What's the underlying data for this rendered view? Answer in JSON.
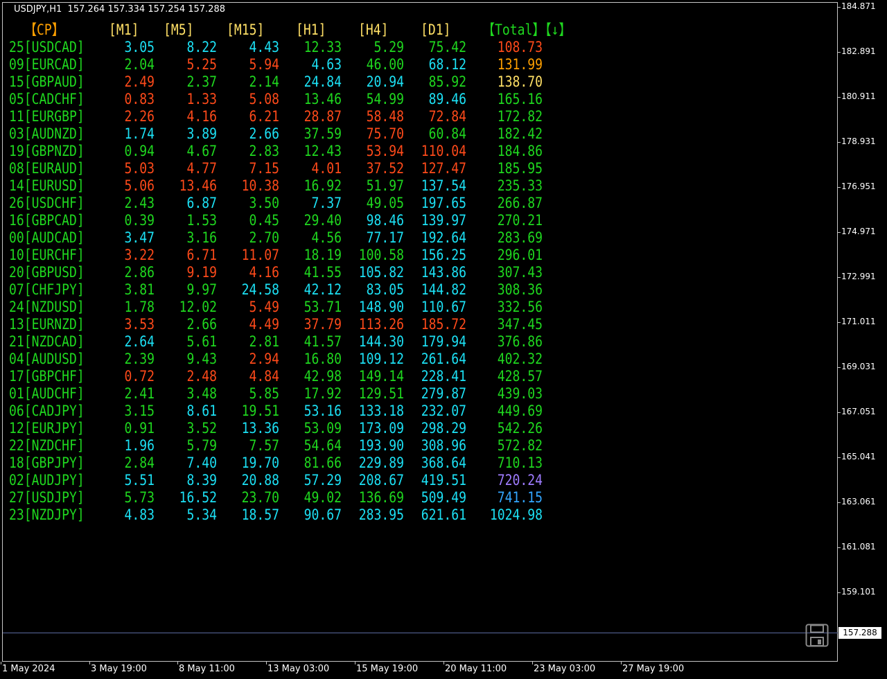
{
  "title": "USDJPY,H1  157.264 157.334 157.254 157.288",
  "colors": {
    "green": "#1fd81f",
    "cyan": "#1ce1f5",
    "red": "#ff4a1a",
    "orange": "#ffa000",
    "yellow": "#ffe066",
    "purple": "#9f7cff",
    "blue": "#33a6ff",
    "background": "#000000"
  },
  "headers": {
    "cp": "【CP】",
    "m1": "[M1]",
    "m5": "[M5]",
    "m15": "[M15]",
    "h1": "[H1]",
    "h4": "[H4]",
    "d1": "[D1]",
    "total": "【Total】【↓】"
  },
  "header_colors": {
    "cp": "#ffa000",
    "m1": "#ffe066",
    "m5": "#ffe066",
    "m15": "#ffe066",
    "h1": "#ffe066",
    "h4": "#ffe066",
    "d1": "#ffe066",
    "total": "#1fd81f"
  },
  "rows": [
    {
      "label": "25[USDCAD]",
      "m1": "3.05",
      "m5": "8.22",
      "m15": "4.43",
      "h1": "12.33",
      "h4": "5.29",
      "d1": "75.42",
      "total": "108.73",
      "c": [
        "cyan",
        "cyan",
        "cyan",
        "green",
        "green",
        "green",
        "red"
      ]
    },
    {
      "label": "09[EURCAD]",
      "m1": "2.04",
      "m5": "5.25",
      "m15": "5.94",
      "h1": "4.63",
      "h4": "46.00",
      "d1": "68.12",
      "total": "131.99",
      "c": [
        "green",
        "red",
        "red",
        "cyan",
        "green",
        "cyan",
        "orange"
      ]
    },
    {
      "label": "15[GBPAUD]",
      "m1": "2.49",
      "m5": "2.37",
      "m15": "2.14",
      "h1": "24.84",
      "h4": "20.94",
      "d1": "85.92",
      "total": "138.70",
      "c": [
        "red",
        "green",
        "green",
        "cyan",
        "cyan",
        "green",
        "yellow"
      ]
    },
    {
      "label": "05[CADCHF]",
      "m1": "0.83",
      "m5": "1.33",
      "m15": "5.08",
      "h1": "13.46",
      "h4": "54.99",
      "d1": "89.46",
      "total": "165.16",
      "c": [
        "red",
        "red",
        "red",
        "green",
        "green",
        "cyan",
        "green"
      ]
    },
    {
      "label": "11[EURGBP]",
      "m1": "2.26",
      "m5": "4.16",
      "m15": "6.21",
      "h1": "28.87",
      "h4": "58.48",
      "d1": "72.84",
      "total": "172.82",
      "c": [
        "red",
        "red",
        "red",
        "red",
        "red",
        "red",
        "green"
      ]
    },
    {
      "label": "03[AUDNZD]",
      "m1": "1.74",
      "m5": "3.89",
      "m15": "2.66",
      "h1": "37.59",
      "h4": "75.70",
      "d1": "60.84",
      "total": "182.42",
      "c": [
        "cyan",
        "cyan",
        "cyan",
        "green",
        "red",
        "green",
        "green"
      ]
    },
    {
      "label": "19[GBPNZD]",
      "m1": "0.94",
      "m5": "4.67",
      "m15": "2.83",
      "h1": "12.43",
      "h4": "53.94",
      "d1": "110.04",
      "total": "184.86",
      "c": [
        "green",
        "green",
        "green",
        "green",
        "red",
        "red",
        "green"
      ]
    },
    {
      "label": "08[EURAUD]",
      "m1": "5.03",
      "m5": "4.77",
      "m15": "7.15",
      "h1": "4.01",
      "h4": "37.52",
      "d1": "127.47",
      "total": "185.95",
      "c": [
        "red",
        "red",
        "red",
        "red",
        "red",
        "red",
        "green"
      ]
    },
    {
      "label": "14[EURUSD]",
      "m1": "5.06",
      "m5": "13.46",
      "m15": "10.38",
      "h1": "16.92",
      "h4": "51.97",
      "d1": "137.54",
      "total": "235.33",
      "c": [
        "red",
        "red",
        "red",
        "green",
        "green",
        "cyan",
        "green"
      ]
    },
    {
      "label": "26[USDCHF]",
      "m1": "2.43",
      "m5": "6.87",
      "m15": "3.50",
      "h1": "7.37",
      "h4": "49.05",
      "d1": "197.65",
      "total": "266.87",
      "c": [
        "green",
        "cyan",
        "green",
        "cyan",
        "green",
        "cyan",
        "green"
      ]
    },
    {
      "label": "16[GBPCAD]",
      "m1": "0.39",
      "m5": "1.53",
      "m15": "0.45",
      "h1": "29.40",
      "h4": "98.46",
      "d1": "139.97",
      "total": "270.21",
      "c": [
        "green",
        "green",
        "green",
        "green",
        "cyan",
        "cyan",
        "green"
      ]
    },
    {
      "label": "00[AUDCAD]",
      "m1": "3.47",
      "m5": "3.16",
      "m15": "2.70",
      "h1": "4.56",
      "h4": "77.17",
      "d1": "192.64",
      "total": "283.69",
      "c": [
        "cyan",
        "green",
        "green",
        "green",
        "cyan",
        "cyan",
        "green"
      ]
    },
    {
      "label": "10[EURCHF]",
      "m1": "3.22",
      "m5": "6.71",
      "m15": "11.07",
      "h1": "18.19",
      "h4": "100.58",
      "d1": "156.25",
      "total": "296.01",
      "c": [
        "red",
        "red",
        "red",
        "green",
        "green",
        "cyan",
        "green"
      ]
    },
    {
      "label": "20[GBPUSD]",
      "m1": "2.86",
      "m5": "9.19",
      "m15": "4.16",
      "h1": "41.55",
      "h4": "105.82",
      "d1": "143.86",
      "total": "307.43",
      "c": [
        "green",
        "red",
        "red",
        "green",
        "cyan",
        "cyan",
        "green"
      ]
    },
    {
      "label": "07[CHFJPY]",
      "m1": "3.81",
      "m5": "9.97",
      "m15": "24.58",
      "h1": "42.12",
      "h4": "83.05",
      "d1": "144.82",
      "total": "308.36",
      "c": [
        "green",
        "green",
        "cyan",
        "cyan",
        "cyan",
        "cyan",
        "green"
      ]
    },
    {
      "label": "24[NZDUSD]",
      "m1": "1.78",
      "m5": "12.02",
      "m15": "5.49",
      "h1": "53.71",
      "h4": "148.90",
      "d1": "110.67",
      "total": "332.56",
      "c": [
        "green",
        "green",
        "red",
        "green",
        "cyan",
        "cyan",
        "green"
      ]
    },
    {
      "label": "13[EURNZD]",
      "m1": "3.53",
      "m5": "2.66",
      "m15": "4.49",
      "h1": "37.79",
      "h4": "113.26",
      "d1": "185.72",
      "total": "347.45",
      "c": [
        "red",
        "green",
        "red",
        "red",
        "red",
        "red",
        "green"
      ]
    },
    {
      "label": "21[NZDCAD]",
      "m1": "2.64",
      "m5": "5.61",
      "m15": "2.81",
      "h1": "41.57",
      "h4": "144.30",
      "d1": "179.94",
      "total": "376.86",
      "c": [
        "cyan",
        "green",
        "green",
        "green",
        "cyan",
        "cyan",
        "green"
      ]
    },
    {
      "label": "04[AUDUSD]",
      "m1": "2.39",
      "m5": "9.43",
      "m15": "2.94",
      "h1": "16.80",
      "h4": "109.12",
      "d1": "261.64",
      "total": "402.32",
      "c": [
        "green",
        "green",
        "red",
        "green",
        "cyan",
        "cyan",
        "green"
      ]
    },
    {
      "label": "17[GBPCHF]",
      "m1": "0.72",
      "m5": "2.48",
      "m15": "4.84",
      "h1": "42.98",
      "h4": "149.14",
      "d1": "228.41",
      "total": "428.57",
      "c": [
        "red",
        "red",
        "red",
        "green",
        "green",
        "cyan",
        "green"
      ]
    },
    {
      "label": "01[AUDCHF]",
      "m1": "2.41",
      "m5": "3.48",
      "m15": "5.85",
      "h1": "17.92",
      "h4": "129.51",
      "d1": "279.87",
      "total": "439.03",
      "c": [
        "green",
        "green",
        "green",
        "green",
        "green",
        "cyan",
        "green"
      ]
    },
    {
      "label": "06[CADJPY]",
      "m1": "3.15",
      "m5": "8.61",
      "m15": "19.51",
      "h1": "53.16",
      "h4": "133.18",
      "d1": "232.07",
      "total": "449.69",
      "c": [
        "green",
        "cyan",
        "green",
        "cyan",
        "cyan",
        "cyan",
        "green"
      ]
    },
    {
      "label": "12[EURJPY]",
      "m1": "0.91",
      "m5": "3.52",
      "m15": "13.36",
      "h1": "53.09",
      "h4": "173.09",
      "d1": "298.29",
      "total": "542.26",
      "c": [
        "green",
        "green",
        "cyan",
        "green",
        "cyan",
        "cyan",
        "green"
      ]
    },
    {
      "label": "22[NZDCHF]",
      "m1": "1.96",
      "m5": "5.79",
      "m15": "7.57",
      "h1": "54.64",
      "h4": "193.90",
      "d1": "308.96",
      "total": "572.82",
      "c": [
        "cyan",
        "green",
        "green",
        "green",
        "cyan",
        "cyan",
        "green"
      ]
    },
    {
      "label": "18[GBPJPY]",
      "m1": "2.84",
      "m5": "7.40",
      "m15": "19.70",
      "h1": "81.66",
      "h4": "229.89",
      "d1": "368.64",
      "total": "710.13",
      "c": [
        "green",
        "cyan",
        "cyan",
        "green",
        "cyan",
        "cyan",
        "green"
      ]
    },
    {
      "label": "02[AUDJPY]",
      "m1": "5.51",
      "m5": "8.39",
      "m15": "20.88",
      "h1": "57.29",
      "h4": "208.67",
      "d1": "419.51",
      "total": "720.24",
      "c": [
        "cyan",
        "cyan",
        "cyan",
        "cyan",
        "cyan",
        "cyan",
        "purple"
      ]
    },
    {
      "label": "27[USDJPY]",
      "m1": "5.73",
      "m5": "16.52",
      "m15": "23.70",
      "h1": "49.02",
      "h4": "136.69",
      "d1": "509.49",
      "total": "741.15",
      "c": [
        "green",
        "cyan",
        "green",
        "green",
        "green",
        "cyan",
        "blue"
      ]
    },
    {
      "label": "23[NZDJPY]",
      "m1": "4.83",
      "m5": "5.34",
      "m15": "18.57",
      "h1": "90.67",
      "h4": "283.95",
      "d1": "621.61",
      "total": "1024.98",
      "c": [
        "cyan",
        "cyan",
        "cyan",
        "cyan",
        "cyan",
        "cyan",
        "cyan"
      ]
    }
  ],
  "price_axis": [
    "184.871",
    "182.891",
    "180.911",
    "178.931",
    "176.951",
    "174.971",
    "172.991",
    "171.011",
    "169.031",
    "167.051",
    "165.041",
    "163.061",
    "161.081",
    "159.101",
    "157.288"
  ],
  "current_price": "157.288",
  "time_axis": [
    "1 May 2024",
    "3 May 19:00",
    "8 May 11:00",
    "13 May 03:00",
    "15 May 19:00",
    "20 May 11:00",
    "23 May 03:00",
    "27 May 19:00"
  ]
}
